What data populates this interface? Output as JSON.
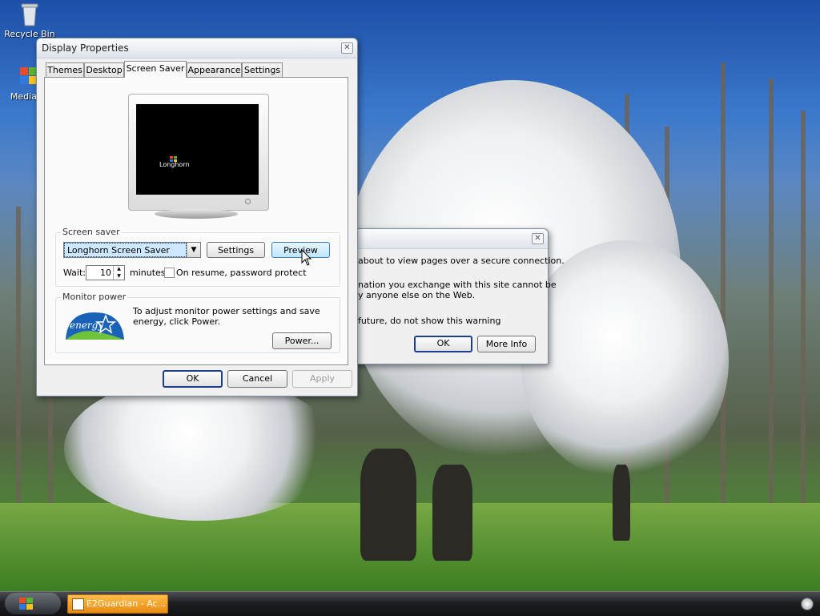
{
  "desktop": {
    "icons": [
      {
        "label": "Recycle Bin"
      },
      {
        "label": "Media C"
      }
    ]
  },
  "display_properties": {
    "title": "Display Properties",
    "tabs": [
      "Themes",
      "Desktop",
      "Screen Saver",
      "Appearance",
      "Settings"
    ],
    "active_tab": "Screen Saver",
    "preview_screen_text": "Longhorn",
    "screensaver_group_label": "Screen saver",
    "screensaver_selected": "Longhorn Screen Saver",
    "settings_button": "Settings",
    "preview_button": "Preview",
    "wait_label": "Wait:",
    "wait_value": "10",
    "minutes_label": "minutes",
    "resume_checkbox_label": "On resume, password protect",
    "resume_checked": false,
    "monitor_power_label": "Monitor power",
    "monitor_power_text": "To adjust monitor power settings and save energy, click Power.",
    "energy_logo_text": "energy",
    "power_button": "Power...",
    "ok_button": "OK",
    "cancel_button": "Cancel",
    "apply_button": "Apply"
  },
  "security_dialog": {
    "line1": "about to view pages over a secure connection.",
    "line2": "nation you exchange with this site cannot be",
    "line3": "y anyone else on the Web.",
    "checkbox_text": "future, do not show this warning",
    "ok_button": "OK",
    "more_info_button": "More Info"
  },
  "taskbar": {
    "task_label": "E2Guardian - Ac..."
  }
}
